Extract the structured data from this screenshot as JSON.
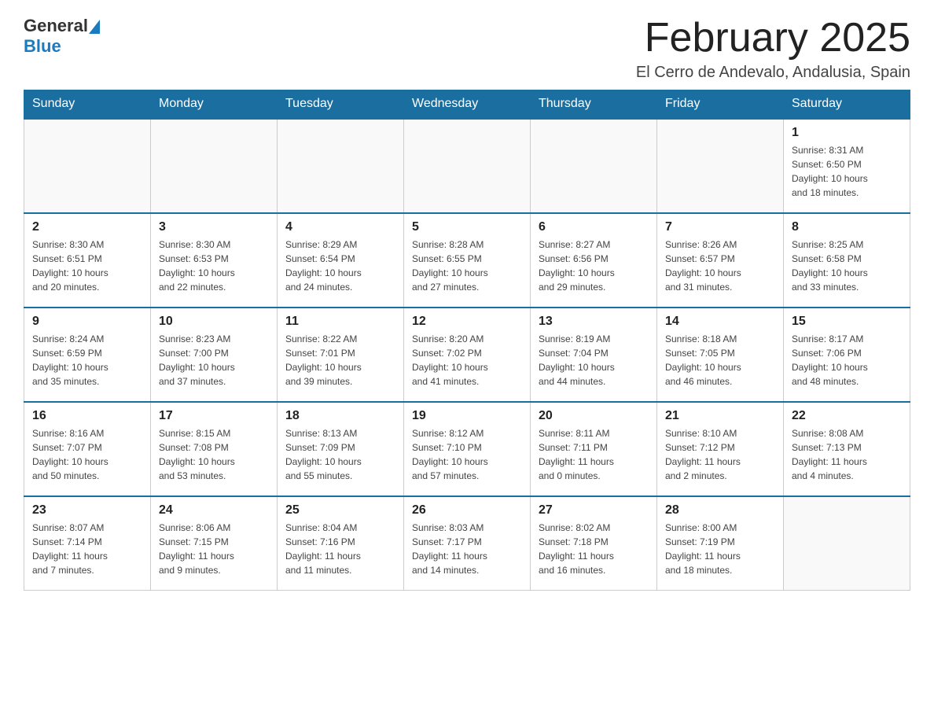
{
  "header": {
    "logo_general": "General",
    "logo_blue": "Blue",
    "month_title": "February 2025",
    "location": "El Cerro de Andevalo, Andalusia, Spain"
  },
  "weekdays": [
    "Sunday",
    "Monday",
    "Tuesday",
    "Wednesday",
    "Thursday",
    "Friday",
    "Saturday"
  ],
  "weeks": [
    [
      {
        "day": "",
        "info": ""
      },
      {
        "day": "",
        "info": ""
      },
      {
        "day": "",
        "info": ""
      },
      {
        "day": "",
        "info": ""
      },
      {
        "day": "",
        "info": ""
      },
      {
        "day": "",
        "info": ""
      },
      {
        "day": "1",
        "info": "Sunrise: 8:31 AM\nSunset: 6:50 PM\nDaylight: 10 hours\nand 18 minutes."
      }
    ],
    [
      {
        "day": "2",
        "info": "Sunrise: 8:30 AM\nSunset: 6:51 PM\nDaylight: 10 hours\nand 20 minutes."
      },
      {
        "day": "3",
        "info": "Sunrise: 8:30 AM\nSunset: 6:53 PM\nDaylight: 10 hours\nand 22 minutes."
      },
      {
        "day": "4",
        "info": "Sunrise: 8:29 AM\nSunset: 6:54 PM\nDaylight: 10 hours\nand 24 minutes."
      },
      {
        "day": "5",
        "info": "Sunrise: 8:28 AM\nSunset: 6:55 PM\nDaylight: 10 hours\nand 27 minutes."
      },
      {
        "day": "6",
        "info": "Sunrise: 8:27 AM\nSunset: 6:56 PM\nDaylight: 10 hours\nand 29 minutes."
      },
      {
        "day": "7",
        "info": "Sunrise: 8:26 AM\nSunset: 6:57 PM\nDaylight: 10 hours\nand 31 minutes."
      },
      {
        "day": "8",
        "info": "Sunrise: 8:25 AM\nSunset: 6:58 PM\nDaylight: 10 hours\nand 33 minutes."
      }
    ],
    [
      {
        "day": "9",
        "info": "Sunrise: 8:24 AM\nSunset: 6:59 PM\nDaylight: 10 hours\nand 35 minutes."
      },
      {
        "day": "10",
        "info": "Sunrise: 8:23 AM\nSunset: 7:00 PM\nDaylight: 10 hours\nand 37 minutes."
      },
      {
        "day": "11",
        "info": "Sunrise: 8:22 AM\nSunset: 7:01 PM\nDaylight: 10 hours\nand 39 minutes."
      },
      {
        "day": "12",
        "info": "Sunrise: 8:20 AM\nSunset: 7:02 PM\nDaylight: 10 hours\nand 41 minutes."
      },
      {
        "day": "13",
        "info": "Sunrise: 8:19 AM\nSunset: 7:04 PM\nDaylight: 10 hours\nand 44 minutes."
      },
      {
        "day": "14",
        "info": "Sunrise: 8:18 AM\nSunset: 7:05 PM\nDaylight: 10 hours\nand 46 minutes."
      },
      {
        "day": "15",
        "info": "Sunrise: 8:17 AM\nSunset: 7:06 PM\nDaylight: 10 hours\nand 48 minutes."
      }
    ],
    [
      {
        "day": "16",
        "info": "Sunrise: 8:16 AM\nSunset: 7:07 PM\nDaylight: 10 hours\nand 50 minutes."
      },
      {
        "day": "17",
        "info": "Sunrise: 8:15 AM\nSunset: 7:08 PM\nDaylight: 10 hours\nand 53 minutes."
      },
      {
        "day": "18",
        "info": "Sunrise: 8:13 AM\nSunset: 7:09 PM\nDaylight: 10 hours\nand 55 minutes."
      },
      {
        "day": "19",
        "info": "Sunrise: 8:12 AM\nSunset: 7:10 PM\nDaylight: 10 hours\nand 57 minutes."
      },
      {
        "day": "20",
        "info": "Sunrise: 8:11 AM\nSunset: 7:11 PM\nDaylight: 11 hours\nand 0 minutes."
      },
      {
        "day": "21",
        "info": "Sunrise: 8:10 AM\nSunset: 7:12 PM\nDaylight: 11 hours\nand 2 minutes."
      },
      {
        "day": "22",
        "info": "Sunrise: 8:08 AM\nSunset: 7:13 PM\nDaylight: 11 hours\nand 4 minutes."
      }
    ],
    [
      {
        "day": "23",
        "info": "Sunrise: 8:07 AM\nSunset: 7:14 PM\nDaylight: 11 hours\nand 7 minutes."
      },
      {
        "day": "24",
        "info": "Sunrise: 8:06 AM\nSunset: 7:15 PM\nDaylight: 11 hours\nand 9 minutes."
      },
      {
        "day": "25",
        "info": "Sunrise: 8:04 AM\nSunset: 7:16 PM\nDaylight: 11 hours\nand 11 minutes."
      },
      {
        "day": "26",
        "info": "Sunrise: 8:03 AM\nSunset: 7:17 PM\nDaylight: 11 hours\nand 14 minutes."
      },
      {
        "day": "27",
        "info": "Sunrise: 8:02 AM\nSunset: 7:18 PM\nDaylight: 11 hours\nand 16 minutes."
      },
      {
        "day": "28",
        "info": "Sunrise: 8:00 AM\nSunset: 7:19 PM\nDaylight: 11 hours\nand 18 minutes."
      },
      {
        "day": "",
        "info": ""
      }
    ]
  ]
}
